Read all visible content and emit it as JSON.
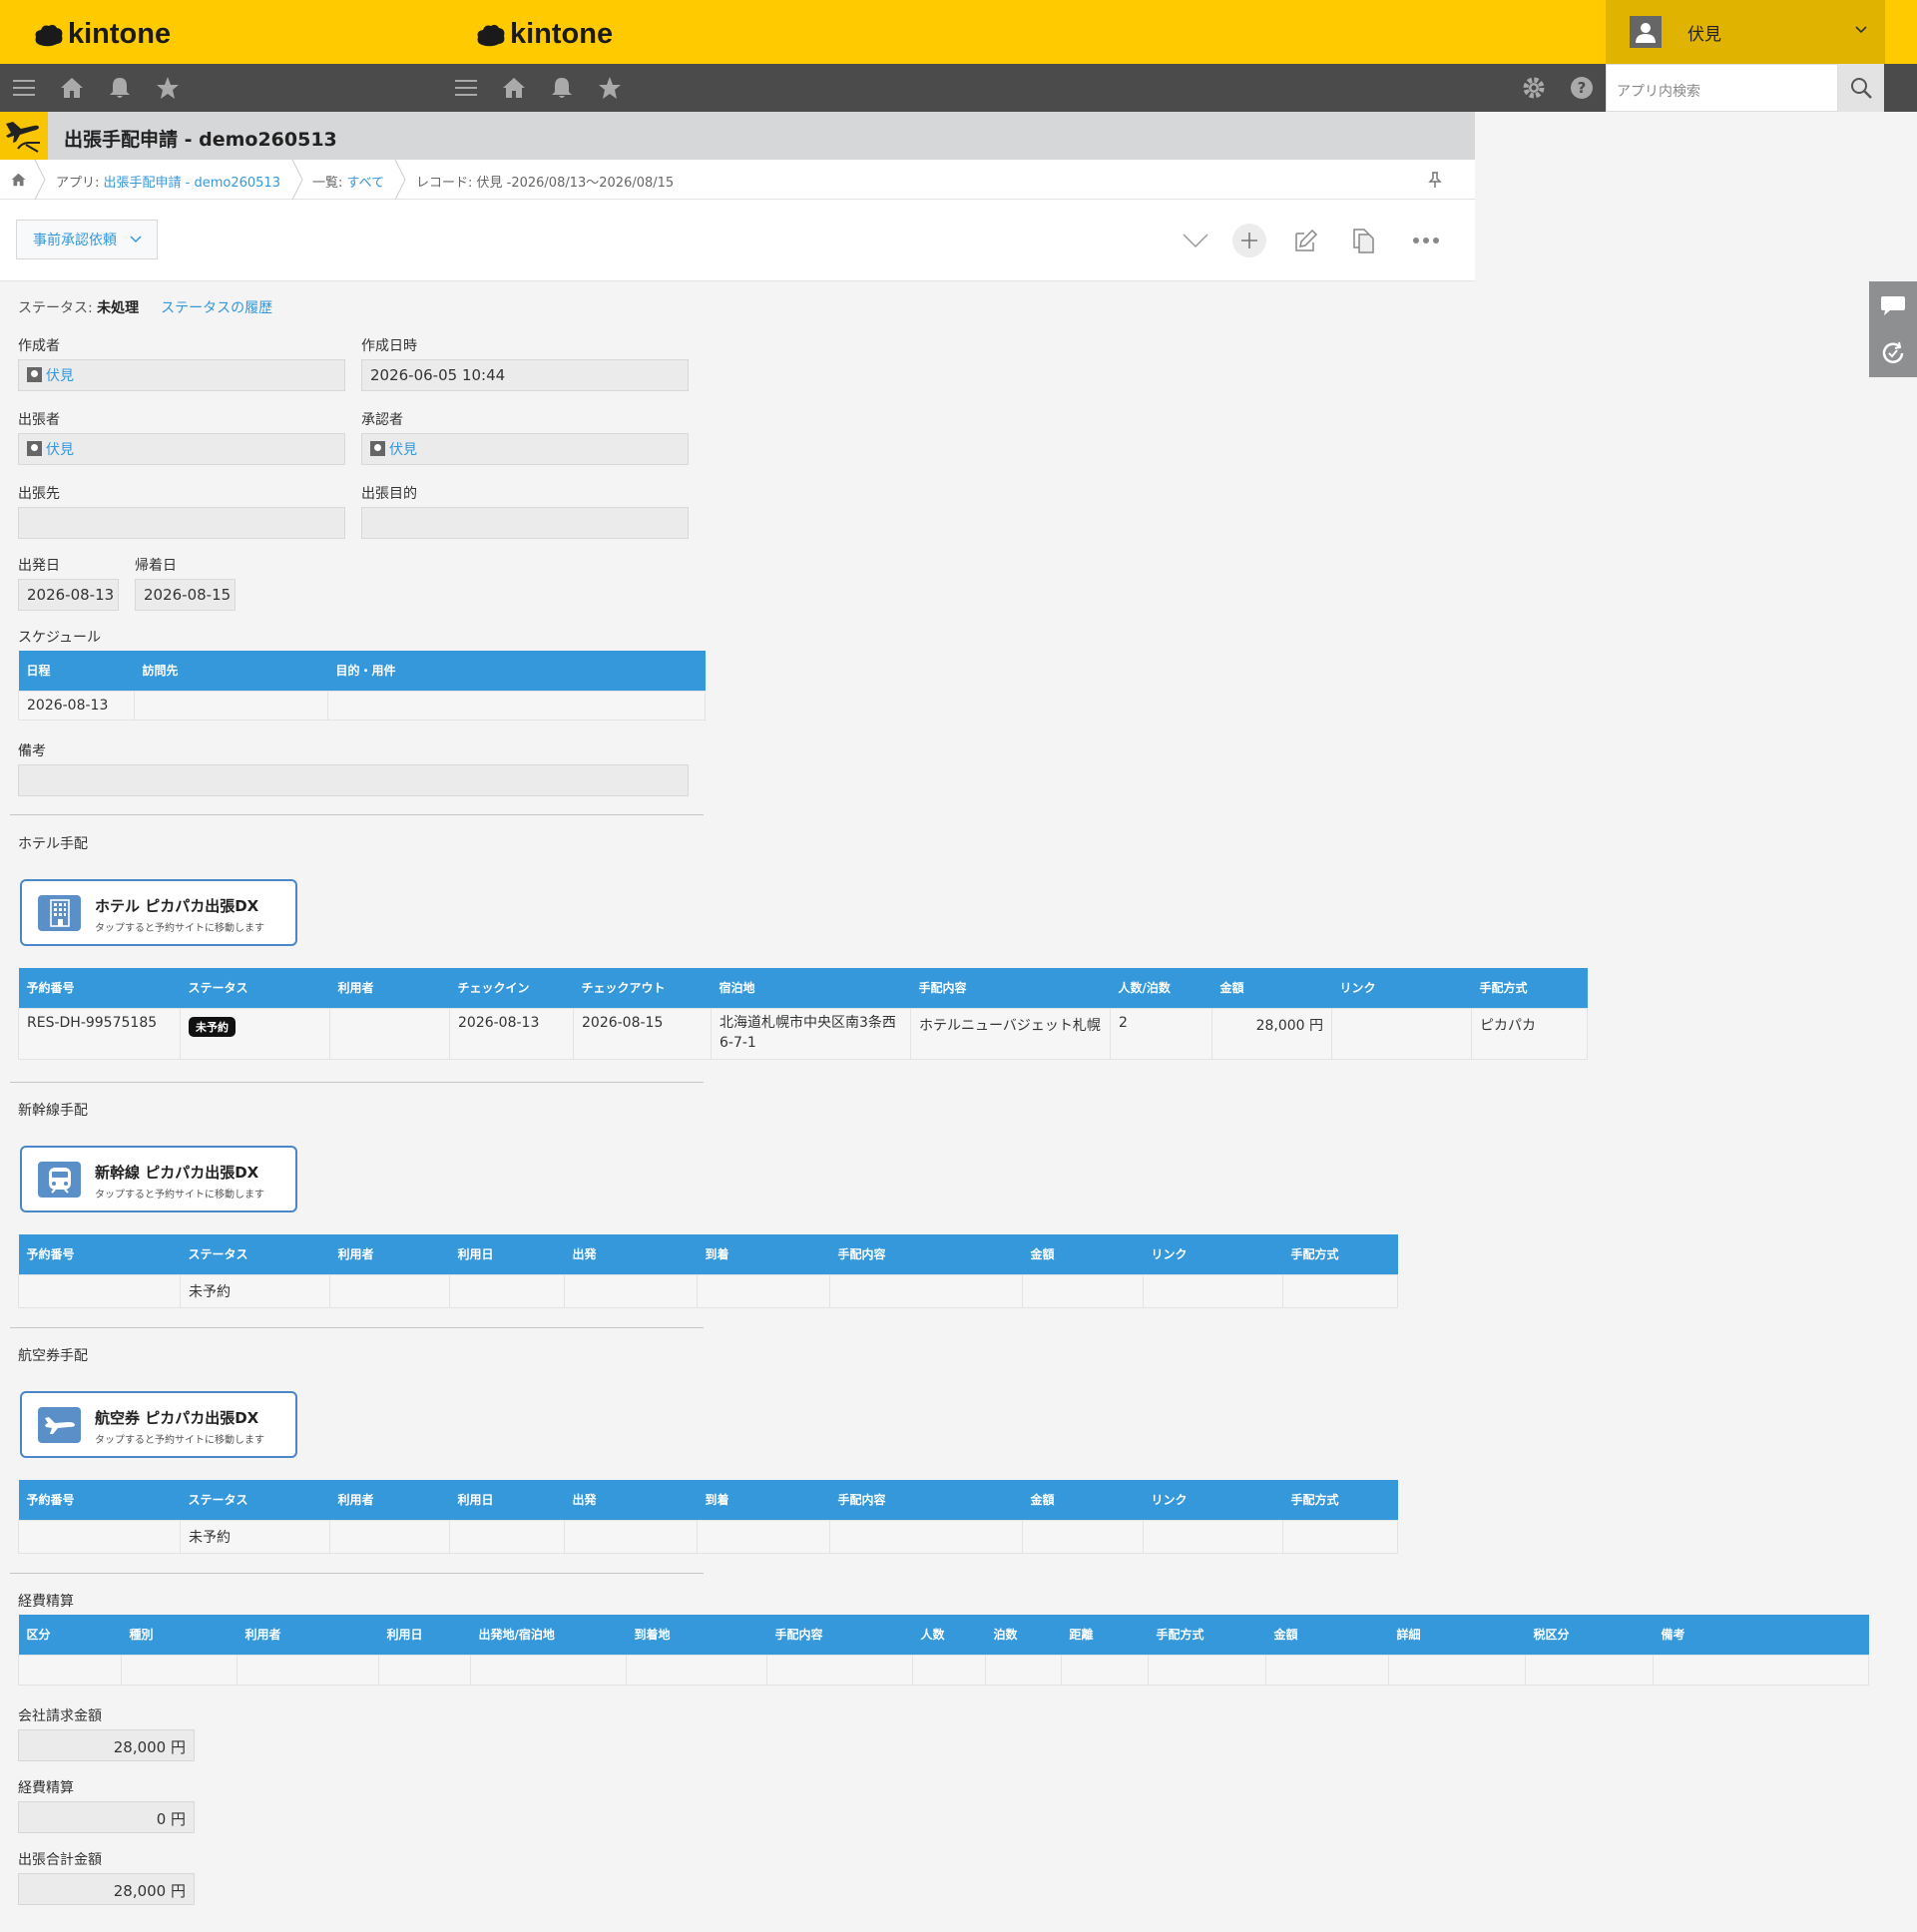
{
  "header": {
    "logo": "kintone",
    "user_name": "伏見",
    "search_placeholder": "アプリ内検索"
  },
  "app": {
    "title": "出張手配申請 - demo260513"
  },
  "breadcrumb": {
    "app_prefix": "アプリ: ",
    "app_link": "出張手配申請 - demo260513",
    "list_prefix": "一覧: ",
    "list_link": "すべて",
    "record": "レコード: 伏見 -2026/08/13〜2026/08/15"
  },
  "toolbar": {
    "action_label": "事前承認依頼"
  },
  "status": {
    "label": "ステータス: ",
    "value": "未処理",
    "history_link": "ステータスの履歴"
  },
  "fields": {
    "creator_label": "作成者",
    "creator": "伏見",
    "created_label": "作成日時",
    "created": "2026-06-05 10:44",
    "traveler_label": "出張者",
    "traveler": "伏見",
    "approver_label": "承認者",
    "approver": "伏見",
    "destination_label": "出張先",
    "destination": "",
    "purpose_label": "出張目的",
    "purpose": "",
    "depart_label": "出発日",
    "depart": "2026-08-13",
    "return_label": "帰着日",
    "return": "2026-08-15",
    "schedule_label": "スケジュール",
    "remarks_label": "備考"
  },
  "schedule": {
    "headers": [
      "日程",
      "訪問先",
      "目的・用件"
    ],
    "rows": [
      [
        "2026-08-13",
        "",
        ""
      ]
    ]
  },
  "hotel": {
    "section_label": "ホテル手配",
    "card_title": "ホテル ピカパカ出張DX",
    "card_sub": "タップすると予約サイトに移動します",
    "headers": [
      "予約番号",
      "ステータス",
      "利用者",
      "チェックイン",
      "チェックアウト",
      "宿泊地",
      "手配内容",
      "人数/泊数",
      "金額",
      "リンク",
      "手配方式"
    ],
    "row": {
      "number": "RES-DH-99575185",
      "status": "未予約",
      "user": "",
      "checkin": "2026-08-13",
      "checkout": "2026-08-15",
      "place_line1": "北海道札幌市中央区南3条西",
      "place_line2": "6-7-1",
      "content": "ホテルニューバジェット札幌",
      "people": "2",
      "amount": "28,000 円",
      "link": "",
      "method": "ピカパカ"
    }
  },
  "shinkansen": {
    "section_label": "新幹線手配",
    "card_title": "新幹線 ピカパカ出張DX",
    "card_sub": "タップすると予約サイトに移動します",
    "headers": [
      "予約番号",
      "ステータス",
      "利用者",
      "利用日",
      "出発",
      "到着",
      "手配内容",
      "金額",
      "リンク",
      "手配方式"
    ],
    "row_status": "未予約"
  },
  "flight": {
    "section_label": "航空券手配",
    "card_title": "航空券 ピカパカ出張DX",
    "card_sub": "タップすると予約サイトに移動します",
    "headers": [
      "予約番号",
      "ステータス",
      "利用者",
      "利用日",
      "出発",
      "到着",
      "手配内容",
      "金額",
      "リンク",
      "手配方式"
    ],
    "row_status": "未予約"
  },
  "expense": {
    "section_label": "経費精算",
    "headers": [
      "区分",
      "種別",
      "利用者",
      "利用日",
      "出発地/宿泊地",
      "到着地",
      "手配内容",
      "人数",
      "泊数",
      "距離",
      "手配方式",
      "金額",
      "詳細",
      "税区分",
      "備考"
    ]
  },
  "totals": {
    "company_label": "会社請求金額",
    "company": "28,000 円",
    "expense_label": "経費精算",
    "expense": "0 円",
    "total_label": "出張合計金額",
    "total": "28,000 円"
  }
}
